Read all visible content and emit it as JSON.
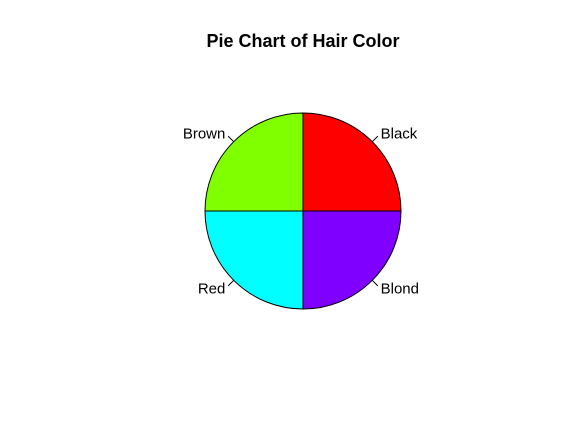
{
  "chart_data": {
    "type": "pie",
    "title": "Pie Chart of Hair Color",
    "start_angle_deg": 0,
    "direction": "counterclockwise",
    "slices": [
      {
        "label": "Black",
        "value": 25,
        "color": "#FF0000"
      },
      {
        "label": "Brown",
        "value": 25,
        "color": "#80FF00"
      },
      {
        "label": "Red",
        "value": 25,
        "color": "#00FFFF"
      },
      {
        "label": "Blond",
        "value": 25,
        "color": "#8000FF"
      }
    ]
  }
}
